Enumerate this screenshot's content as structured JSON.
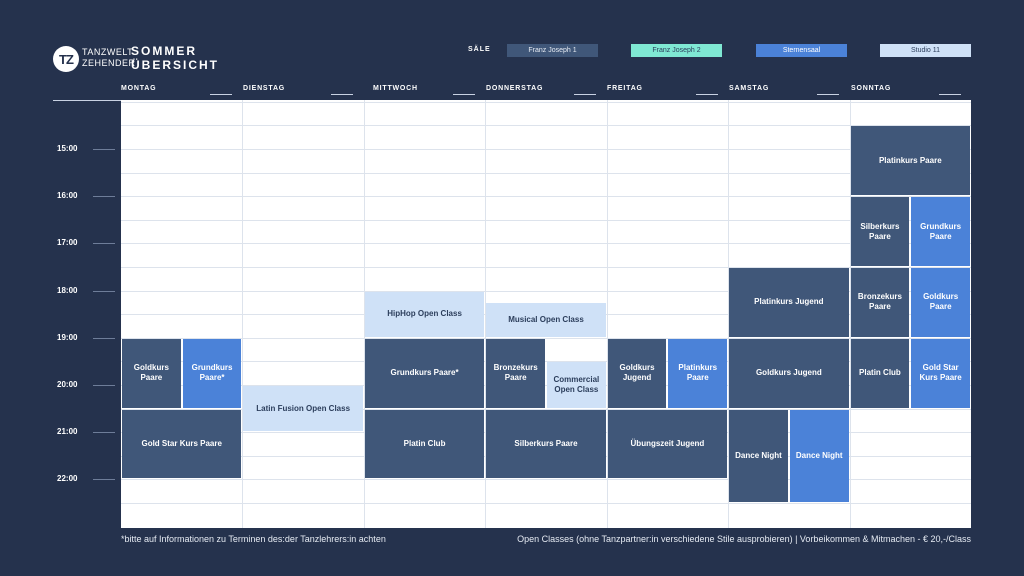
{
  "logo": {
    "initials": "TZ",
    "line1": "TANZWELT",
    "line2": "ZEHENDER"
  },
  "title": {
    "line1": "SOMMER",
    "line2": "ÜBERSICHT"
  },
  "rooms_label": "SÄLE",
  "rooms": [
    {
      "key": "fj1",
      "label": "Franz Joseph 1",
      "color": "#405779",
      "text_color": "#e6ebf3"
    },
    {
      "key": "fj2",
      "label": "Franz Joseph 2",
      "color": "#7fe8d3",
      "text_color": "#2c3e5c"
    },
    {
      "key": "ster",
      "label": "Sternensaal",
      "color": "#4b82d8",
      "text_color": "#ffffff"
    },
    {
      "key": "st11",
      "label": "Studio 11",
      "color": "#cfe1f7",
      "text_color": "#2c3e5c"
    }
  ],
  "days": [
    "MONTAG",
    "DIENSTAG",
    "MITTWOCH",
    "DONNERSTAG",
    "FREITAG",
    "SAMSTAG",
    "SONNTAG"
  ],
  "times": [
    "15:00",
    "16:00",
    "17:00",
    "18:00",
    "19:00",
    "20:00",
    "21:00",
    "22:00"
  ],
  "events": [
    {
      "label": "Goldkurs Paare",
      "day": "MONTAG",
      "room": "fj1",
      "start": "19:00",
      "end": "20:30"
    },
    {
      "label": "Grundkurs Paare*",
      "day": "MONTAG",
      "room": "ster",
      "start": "19:00",
      "end": "20:30"
    },
    {
      "label": "Gold Star Kurs Paare",
      "day": "MONTAG",
      "room": "fj1",
      "start": "20:30",
      "end": "22:00"
    },
    {
      "label": "Latin Fusion Open Class",
      "day": "DIENSTAG",
      "room": "st11",
      "start": "20:00",
      "end": "21:00"
    },
    {
      "label": "HipHop Open Class",
      "day": "MITTWOCH",
      "room": "st11",
      "start": "18:00",
      "end": "19:00"
    },
    {
      "label": "Grundkurs Paare*",
      "day": "MITTWOCH",
      "room": "fj1",
      "start": "19:00",
      "end": "20:30"
    },
    {
      "label": "Platin Club",
      "day": "MITTWOCH",
      "room": "fj1",
      "start": "20:30",
      "end": "22:00"
    },
    {
      "label": "Musical Open Class",
      "day": "DONNERSTAG",
      "room": "st11",
      "start": "18:15",
      "end": "19:00"
    },
    {
      "label": "Bronzekurs Paare",
      "day": "DONNERSTAG",
      "room": "fj1",
      "start": "19:00",
      "end": "20:30"
    },
    {
      "label": "Commercial Open Class",
      "day": "DONNERSTAG",
      "room": "st11",
      "start": "19:30",
      "end": "20:30"
    },
    {
      "label": "Silberkurs Paare",
      "day": "DONNERSTAG",
      "room": "fj1",
      "start": "20:30",
      "end": "22:00"
    },
    {
      "label": "Goldkurs Jugend",
      "day": "FREITAG",
      "room": "fj1",
      "start": "19:00",
      "end": "20:30"
    },
    {
      "label": "Platinkurs Paare",
      "day": "FREITAG",
      "room": "ster",
      "start": "19:00",
      "end": "20:30"
    },
    {
      "label": "Übungszeit Jugend",
      "day": "FREITAG",
      "room": "fj1",
      "start": "20:30",
      "end": "22:00"
    },
    {
      "label": "Platinkurs Jugend",
      "day": "SAMSTAG",
      "room": "fj1",
      "start": "17:30",
      "end": "19:00"
    },
    {
      "label": "Goldkurs Jugend",
      "day": "SAMSTAG",
      "room": "fj1",
      "start": "19:00",
      "end": "20:30"
    },
    {
      "label": "Dance Night",
      "day": "SAMSTAG",
      "room": "fj1",
      "start": "20:30",
      "end": "22:30"
    },
    {
      "label": "Dance Night",
      "day": "SAMSTAG",
      "room": "ster",
      "start": "20:30",
      "end": "22:30"
    },
    {
      "label": "Platinkurs Paare",
      "day": "SONNTAG",
      "room": "fj1",
      "start": "14:30",
      "end": "16:00"
    },
    {
      "label": "Silberkurs Paare",
      "day": "SONNTAG",
      "room": "fj1",
      "start": "16:00",
      "end": "17:30"
    },
    {
      "label": "Grundkurs Paare",
      "day": "SONNTAG",
      "room": "ster",
      "start": "16:00",
      "end": "17:30"
    },
    {
      "label": "Bronzekurs Paare",
      "day": "SONNTAG",
      "room": "fj1",
      "start": "17:30",
      "end": "19:00"
    },
    {
      "label": "Goldkurs Paare",
      "day": "SONNTAG",
      "room": "ster",
      "start": "17:30",
      "end": "19:00"
    },
    {
      "label": "Platin Club",
      "day": "SONNTAG",
      "room": "fj1",
      "start": "19:00",
      "end": "20:30"
    },
    {
      "label": "Gold Star Kurs Paare",
      "day": "SONNTAG",
      "room": "ster",
      "start": "19:00",
      "end": "20:30"
    }
  ],
  "footer": {
    "note": "*bitte auf Informationen zu Terminen des:der Tanzlehrers:in achten",
    "info": "Open Classes (ohne Tanzpartner:in verschiedene Stile ausprobieren) | Vorbeikommen & Mitmachen - € 20,-/Class"
  }
}
